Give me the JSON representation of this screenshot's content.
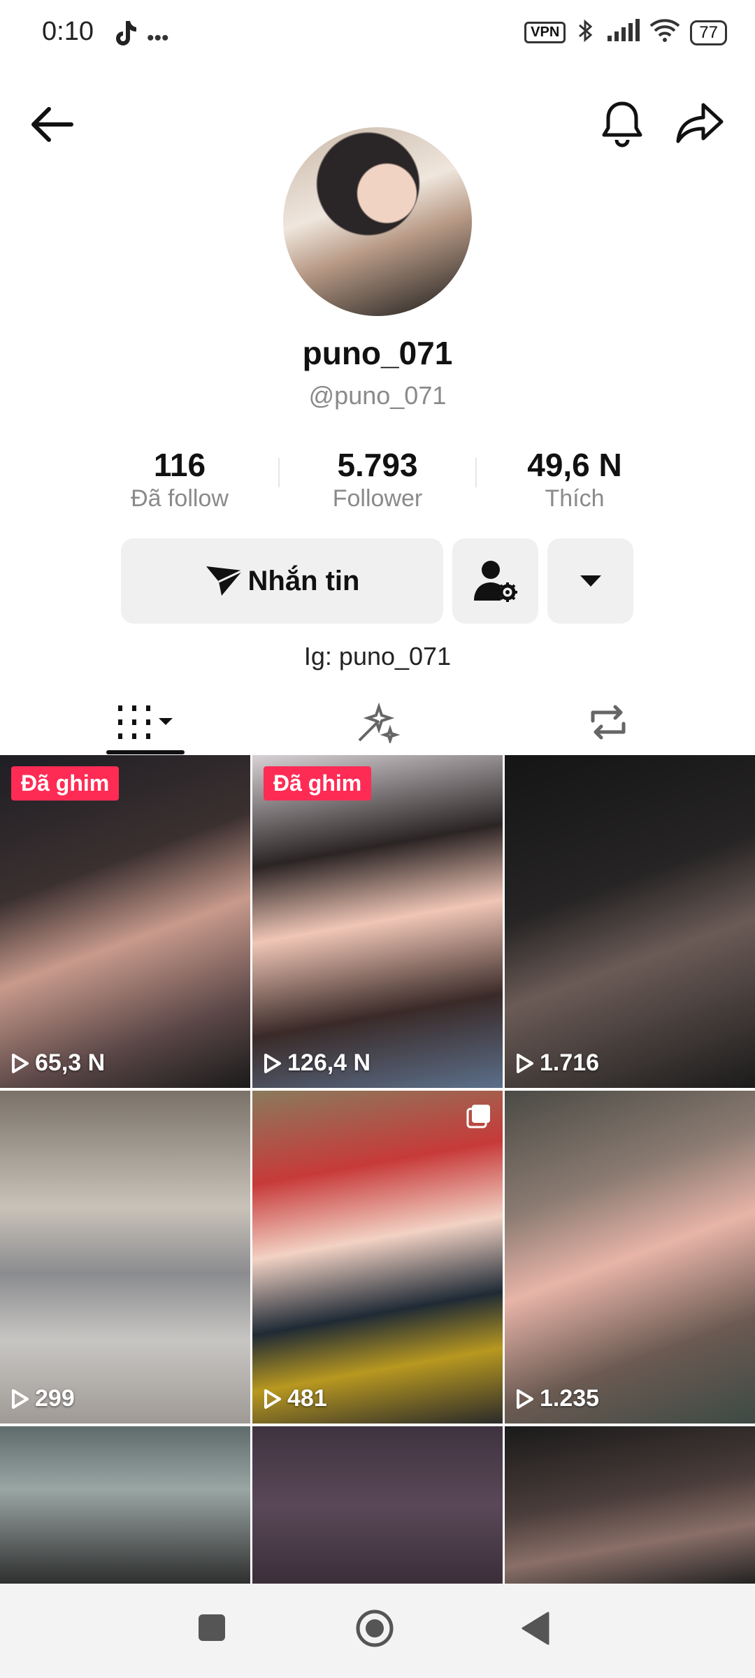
{
  "status": {
    "time": "0:10",
    "vpn": "VPN",
    "battery": "77"
  },
  "profile": {
    "display_name": "puno_071",
    "handle": "@puno_071",
    "bio": "Ig: puno_071"
  },
  "stats": [
    {
      "value": "116",
      "label": "Đã follow"
    },
    {
      "value": "5.793",
      "label": "Follower"
    },
    {
      "value": "49,6 N",
      "label": "Thích"
    }
  ],
  "actions": {
    "message_label": "Nhắn tin"
  },
  "videos": [
    {
      "views": "65,3 N",
      "pinned_label": "Đã ghim",
      "pinned": true
    },
    {
      "views": "126,4 N",
      "pinned_label": "Đã ghim",
      "pinned": true
    },
    {
      "views": "1.716"
    },
    {
      "views": "299"
    },
    {
      "views": "481",
      "multi": true
    },
    {
      "views": "1.235"
    },
    {
      "views": ""
    },
    {
      "views": ""
    },
    {
      "views": ""
    }
  ],
  "icons": {
    "back": "back-arrow-icon",
    "bell": "bell-icon",
    "share": "share-icon",
    "add_friend": "user-settings-icon",
    "dropdown": "caret-down-icon",
    "videos_tab": "grid-icon",
    "favorites_tab": "sparkle-icon",
    "reposts_tab": "repost-icon"
  },
  "colors": {
    "pin_bg": "#fe2c55",
    "button_bg": "#f0f0f0"
  }
}
